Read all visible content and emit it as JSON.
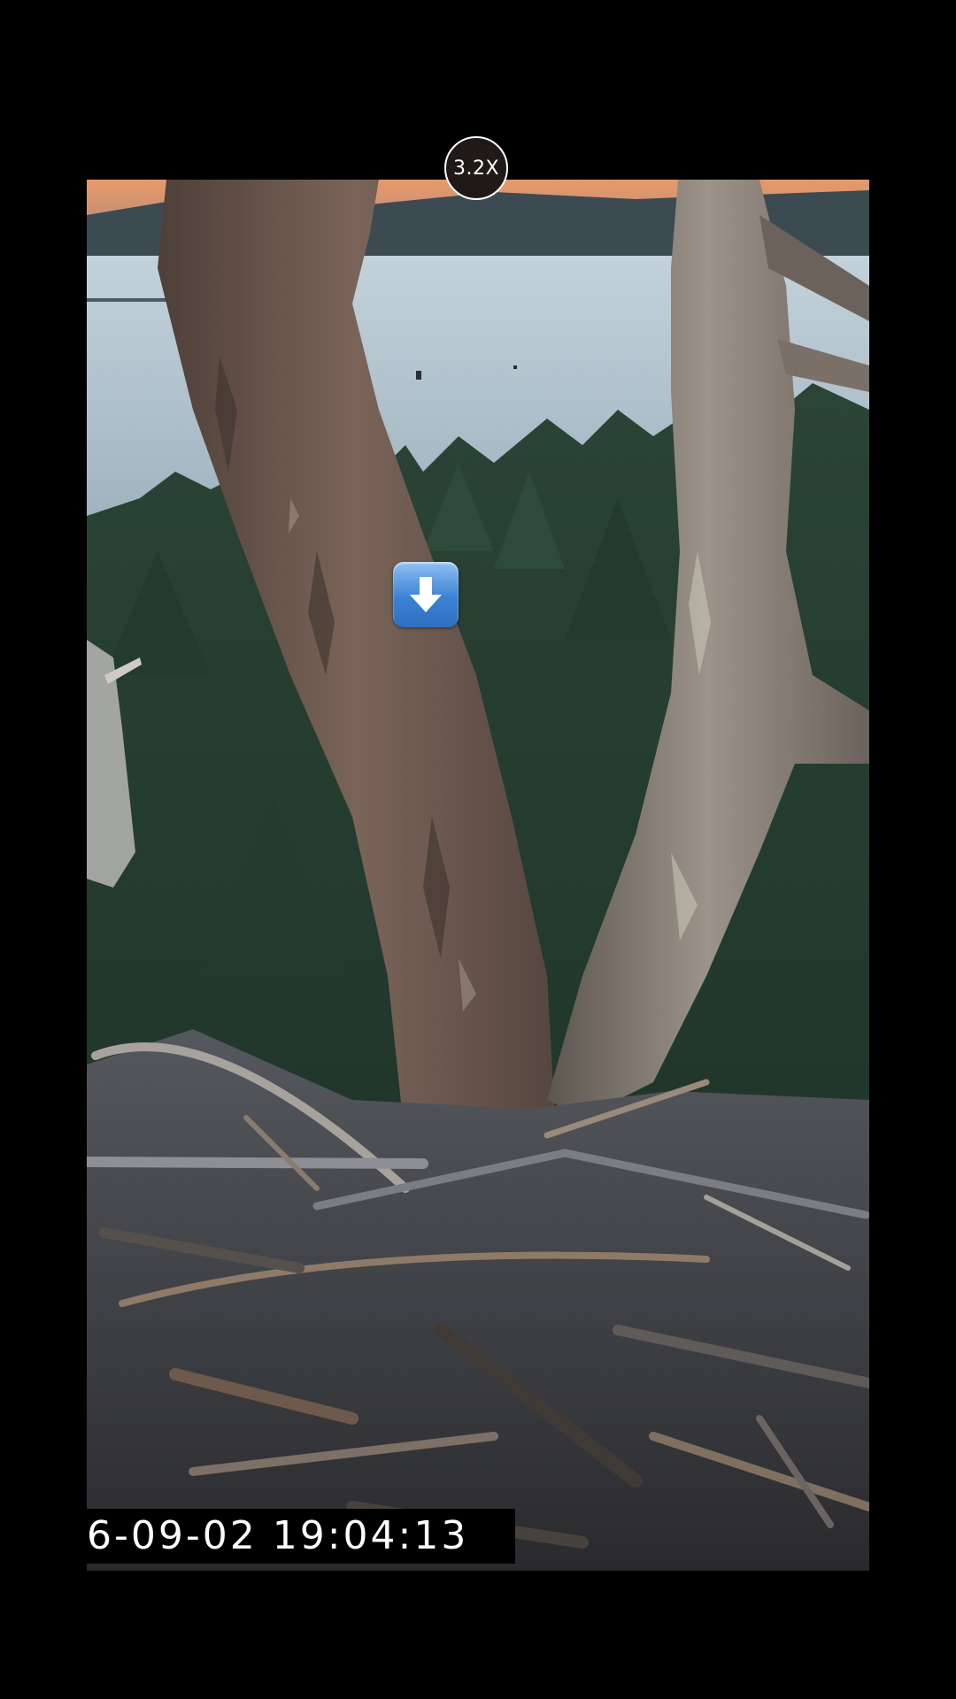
{
  "zoom": {
    "label": "3.2X"
  },
  "overlay": {
    "download_icon": "down-arrow-icon"
  },
  "camera": {
    "timestamp": "6-09-02  19:04:13"
  },
  "colors": {
    "sky": "#d98a5f",
    "lake": "#aebfc9",
    "forest": "#1f3a2c",
    "trunk": "#6e5a50",
    "nest": "#4a4a4e",
    "badge_bg": "#1f1a18",
    "download_blue": "#3b82d4"
  }
}
